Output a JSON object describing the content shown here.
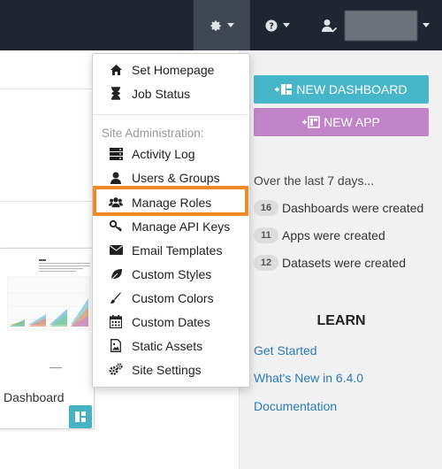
{
  "navbar": {
    "gear_menu": "settings",
    "help_menu": "help",
    "user_menu": "user"
  },
  "dropdown": {
    "items_top": [
      {
        "label": "Set Homepage",
        "icon": "home-icon"
      },
      {
        "label": "Job Status",
        "icon": "hourglass-icon"
      }
    ],
    "section_header": "Site Administration:",
    "items_admin": [
      {
        "label": "Activity Log",
        "icon": "server-icon"
      },
      {
        "label": "Users & Groups",
        "icon": "user-icon"
      },
      {
        "label": "Manage Roles",
        "icon": "users-icon"
      },
      {
        "label": "Manage API Keys",
        "icon": "key-icon"
      },
      {
        "label": "Email Templates",
        "icon": "envelope-icon"
      },
      {
        "label": "Custom Styles",
        "icon": "leaf-icon"
      },
      {
        "label": "Custom Colors",
        "icon": "paintbrush-icon"
      },
      {
        "label": "Custom Dates",
        "icon": "calendar-icon"
      },
      {
        "label": "Static Assets",
        "icon": "image-file-icon"
      },
      {
        "label": "Site Settings",
        "icon": "cogs-icon"
      }
    ],
    "highlighted": "Manage Roles",
    "highlight_color": "#f08a24"
  },
  "card": {
    "title": "Dashboard"
  },
  "actions": {
    "new_dashboard": "NEW DASHBOARD",
    "new_app": "NEW APP",
    "dashboard_color": "#46b6c8",
    "app_color": "#c184c9"
  },
  "stats": {
    "title": "Over the last 7 days...",
    "rows": [
      {
        "count": "16",
        "label": "Dashboards were created"
      },
      {
        "count": "11",
        "label": "Apps were created"
      },
      {
        "count": "12",
        "label": "Datasets were created"
      }
    ]
  },
  "learn": {
    "title": "LEARN",
    "links": [
      "Get Started",
      "What's New in 6.4.0",
      "Documentation"
    ]
  }
}
